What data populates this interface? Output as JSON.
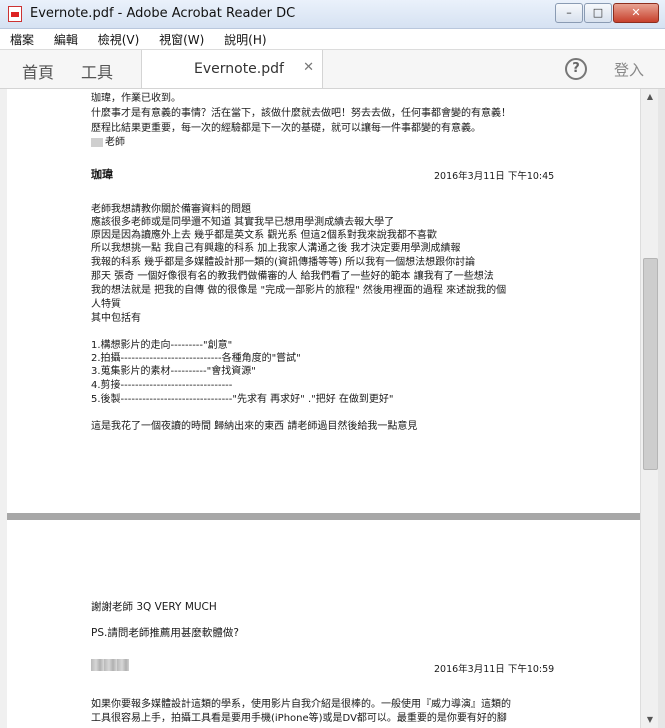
{
  "window": {
    "title": "Evernote.pdf - Adobe Acrobat Reader DC",
    "min": "–",
    "max": "□",
    "close": "✕"
  },
  "menu": [
    "檔案",
    "編輯",
    "檢視(V)",
    "視窗(W)",
    "說明(H)"
  ],
  "toolbar": {
    "home": "首頁",
    "tools": "工具",
    "tab": "Evernote.pdf",
    "tab_close": "✕",
    "help": "?",
    "signin": "登入"
  },
  "page1": {
    "intro": [
      "珈瑋，作業已收到。",
      "什麼事才是有意義的事情？活在當下，該做什麼就去做吧！努去去做，任何事都會變的有意義！",
      "歷程比結果更重要，每一次的經驗都是下一次的基礎，就可以讓每一件事都變的有意義。"
    ],
    "teacher": "老師",
    "author": "珈瑋",
    "date": "2016年3月11日 下午10:45",
    "body": [
      "老師我想請教你關於備審資料的問題",
      "應該很多老師或是同學還不知道 其實我早已想用學測成績去報大學了",
      "原因是因為讀應外上去 幾乎都是英文系 觀光系 但這2個系對我來說我都不喜歡",
      "所以我想挑一點 我自己有興趣的科系 加上我家人溝通之後 我才決定要用學測成績報",
      "我報的科系 幾乎都是多媒體設計那一類的(資訊傳播等等)  所以我有一個想法想跟你討論",
      "那天 張奇  一個好像很有名的教我們做備審的人 給我們看了一些好的範本 讓我有了一些想法",
      "我的想法就是 把我的自傳 做的很像是 \"完成一部影片的旅程\" 然後用裡面的過程 來述說我的個",
      "人特質",
      "其中包括有"
    ],
    "list": [
      "1.構想影片的走向---------\"創意\"",
      "2.拍攝----------------------------各種角度的\"嘗試\"",
      "3.蒐集影片的素材----------\"會找資源\"",
      "4.剪接-------------------------------",
      "5.後製-------------------------------\"先求有 再求好\" .\"把好 在做到更好\""
    ],
    "closing": "這是我花了一個夜讀的時間 歸納出來的東西 請老師過目然後給我一點意見"
  },
  "page2": {
    "thanks": "謝謝老師 3Q VERY MUCH",
    "ps": "PS.請問老師推薦用甚麼軟體做?",
    "date": "2016年3月11日 下午10:59",
    "reply": [
      "如果你要報多媒體設計這類的學系，使用影片自我介紹是很棒的。一般使用『威力導演』這類的",
      "工具很容易上手，拍攝工具看是要用手機(iPhone等)或是DV都可以。最重要的是你要有好的腳"
    ]
  }
}
